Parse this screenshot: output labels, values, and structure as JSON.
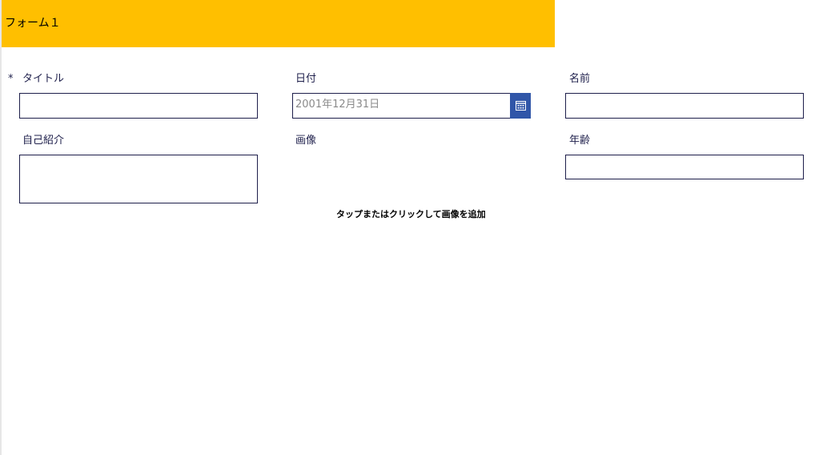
{
  "header": {
    "title": "フォーム１",
    "background_color": "#ffbf00"
  },
  "form": {
    "required_marker": "*",
    "fields": {
      "title": {
        "label": "タイトル",
        "value": ""
      },
      "date": {
        "label": "日付",
        "value": "2001年12月31日",
        "icon": "calendar-icon"
      },
      "name": {
        "label": "名前",
        "value": ""
      },
      "intro": {
        "label": "自己紹介",
        "value": ""
      },
      "image": {
        "label": "画像",
        "hint": "タップまたはクリックして画像を追加"
      },
      "age": {
        "label": "年齢",
        "value": ""
      }
    }
  },
  "colors": {
    "text": "#1e1f4b",
    "border": "#1e1f4b",
    "calendar_button": "#3056a8",
    "date_placeholder_text": "#8a8a8a"
  }
}
